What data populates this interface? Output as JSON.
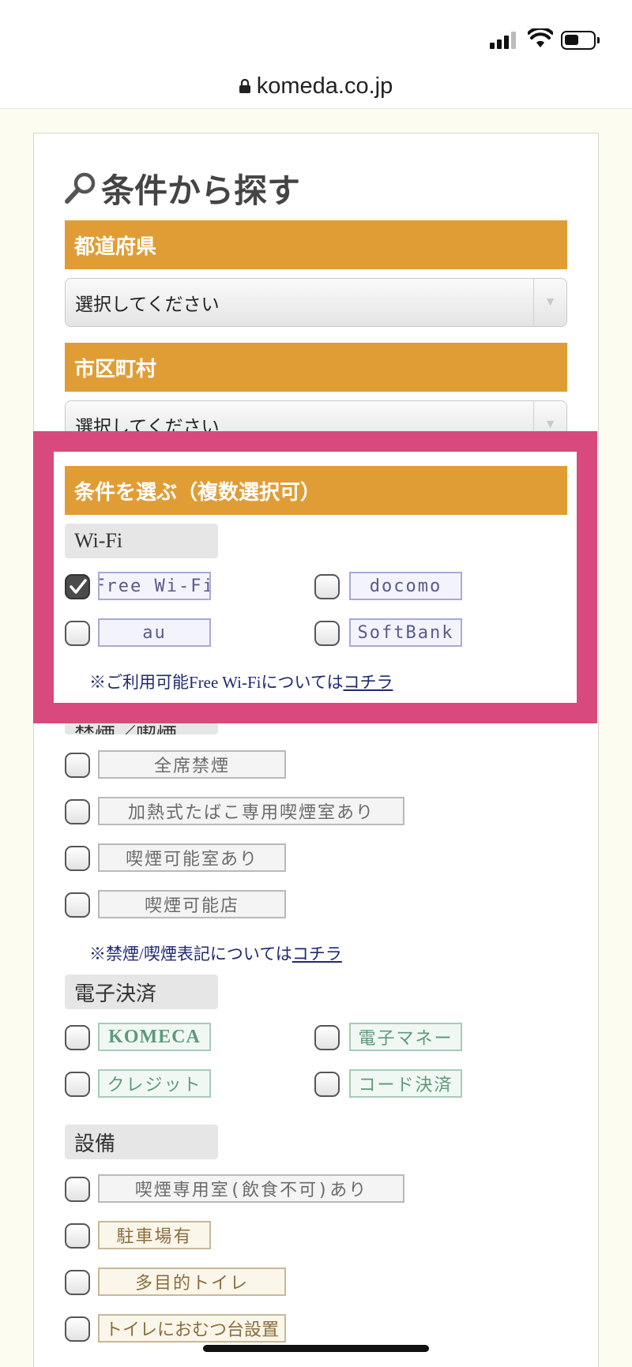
{
  "browser": {
    "url": "komeda.co.jp"
  },
  "page": {
    "title": "条件から探す"
  },
  "prefecture": {
    "header": "都道府県",
    "select_value": "選択してください"
  },
  "city": {
    "header": "市区町村",
    "select_value": "選択してください"
  },
  "conditions": {
    "header": "条件を選ぶ（複数選択可）"
  },
  "wifi": {
    "label": "Wi-Fi",
    "options": [
      {
        "label": "Free Wi-Fi",
        "checked": true
      },
      {
        "label": "docomo",
        "checked": false
      },
      {
        "label": "au",
        "checked": false
      },
      {
        "label": "SoftBank",
        "checked": false
      }
    ],
    "note_prefix": "※ご利用可能Free Wi-Fiについては",
    "note_link": "コチラ"
  },
  "smoking": {
    "label_partial": "禁煙／喫煙",
    "options": [
      {
        "label": "全席禁煙",
        "checked": false
      },
      {
        "label": "加熱式たばこ専用喫煙室あり",
        "checked": false
      },
      {
        "label": "喫煙可能室あり",
        "checked": false
      },
      {
        "label": "喫煙可能店",
        "checked": false
      }
    ],
    "note_prefix": "※禁煙/喫煙表記については",
    "note_link": "コチラ"
  },
  "payment": {
    "label": "電子決済",
    "options": [
      {
        "label": "KOMECA",
        "checked": false
      },
      {
        "label": "電子マネー",
        "checked": false
      },
      {
        "label": "クレジット",
        "checked": false
      },
      {
        "label": "コード決済",
        "checked": false
      }
    ]
  },
  "facilities": {
    "label": "設備",
    "options": [
      {
        "label": "喫煙専用室(飲食不可)あり",
        "checked": false
      },
      {
        "label": "駐車場有",
        "checked": false
      },
      {
        "label": "多目的トイレ",
        "checked": false
      },
      {
        "label": "トイレにおむつ台設置",
        "checked": false
      }
    ]
  },
  "colors": {
    "section_header": "#e19d35",
    "highlight_frame": "#d84a7e",
    "page_background": "#fdfcf0",
    "link": "#1f2a70"
  },
  "icons": {
    "search": "magnifier-icon",
    "lock": "lock-icon",
    "check": "checkmark-icon"
  }
}
